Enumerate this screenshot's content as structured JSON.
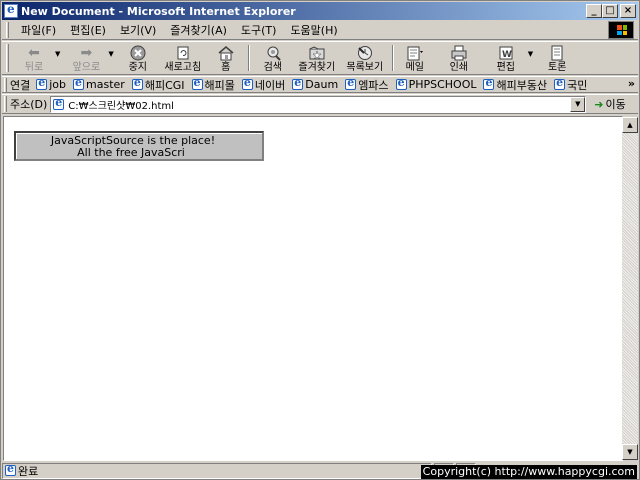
{
  "window": {
    "title": "New Document - Microsoft Internet Explorer",
    "buttons": {
      "minimize": "_",
      "maximize": "□",
      "close": "×"
    }
  },
  "menu": [
    "파일(F)",
    "편집(E)",
    "보기(V)",
    "즐겨찾기(A)",
    "도구(T)",
    "도움말(H)"
  ],
  "toolbar": {
    "back": "뒤로",
    "forward": "앞으로",
    "stop": "중지",
    "refresh": "새로고침",
    "home": "홈",
    "search": "검색",
    "favorites": "즐겨찾기",
    "history": "목록보기",
    "mail": "메일",
    "print": "인쇄",
    "edit": "편집",
    "discuss": "토론"
  },
  "links": {
    "label": "연결",
    "items": [
      "job",
      "master",
      "해피CGI",
      "해피몰",
      "네이버",
      "Daum",
      "엠파스",
      "PHPSCHOOL",
      "해피부동산",
      "국민"
    ],
    "more": "»"
  },
  "address": {
    "label": "주소(D)",
    "value": "C:₩스크린샷₩02.html",
    "go": "이동"
  },
  "content": {
    "marquee_line1": "JavaScriptSource is the place!",
    "marquee_line2": "All the free JavaScri"
  },
  "status": {
    "text": "완료",
    "copyright": "Copyright(c) http://www.happycgi.com"
  },
  "colors": {
    "title_start": "#0a246a",
    "title_end": "#a6caf0",
    "chrome": "#d4d0c8"
  }
}
